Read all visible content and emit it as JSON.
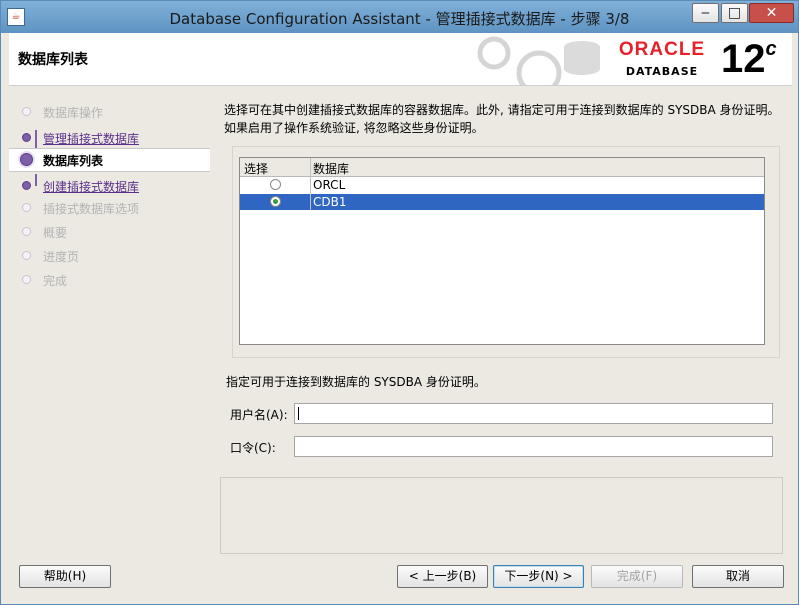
{
  "window": {
    "title": "Database Configuration Assistant - 管理插接式数据库 - 步骤 3/8",
    "icon": "java-icon",
    "controls": {
      "minimize": "‒",
      "maximize": "□",
      "close": "✕"
    }
  },
  "header": {
    "page_title": "数据库列表",
    "brand": "ORACLE",
    "brand_sub": "DATABASE",
    "version": "12",
    "version_sup": "c"
  },
  "sidebar": {
    "steps": [
      {
        "label": "数据库操作",
        "state": "disabled"
      },
      {
        "label": "管理插接式数据库",
        "state": "done"
      },
      {
        "label": "数据库列表",
        "state": "current"
      },
      {
        "label": "创建插接式数据库",
        "state": "done"
      },
      {
        "label": "插接式数据库选项",
        "state": "disabled"
      },
      {
        "label": "概要",
        "state": "disabled"
      },
      {
        "label": "进度页",
        "state": "disabled"
      },
      {
        "label": "完成",
        "state": "disabled"
      }
    ]
  },
  "main": {
    "description_line1": "选择可在其中创建插接式数据库的容器数据库。此外, 请指定可用于连接到数据库的 SYSDBA 身份证明。",
    "description_line2": "如果启用了操作系统验证, 将忽略这些身份证明。",
    "table": {
      "columns": [
        "选择",
        "数据库"
      ],
      "rows": [
        {
          "selected": false,
          "name": "ORCL"
        },
        {
          "selected": true,
          "name": "CDB1"
        }
      ]
    },
    "credentials_hint": "指定可用于连接到数据库的 SYSDBA 身份证明。",
    "username_label": "用户名(A):",
    "username_value": "",
    "password_label": "口令(C):",
    "password_value": ""
  },
  "buttons": {
    "help": "帮助(H)",
    "back": "< 上一步(B)",
    "next": "下一步(N) >",
    "finish": "完成(F)",
    "cancel": "取消"
  },
  "colors": {
    "selection": "#2f66c2",
    "accent_purple": "#7c5fa6",
    "oracle_red": "#e8202a"
  }
}
